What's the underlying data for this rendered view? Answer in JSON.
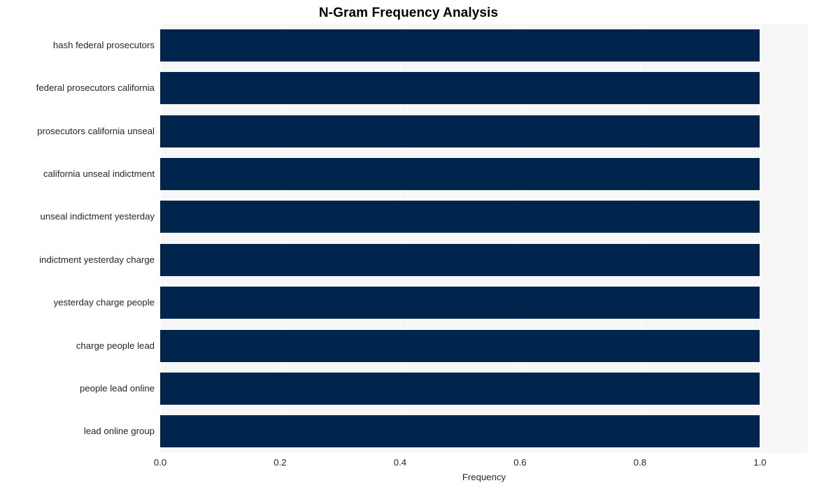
{
  "chart_data": {
    "type": "bar",
    "orientation": "horizontal",
    "title": "N-Gram Frequency Analysis",
    "xlabel": "Frequency",
    "ylabel": "",
    "categories": [
      "hash federal prosecutors",
      "federal prosecutors california",
      "prosecutors california unseal",
      "california unseal indictment",
      "unseal indictment yesterday",
      "indictment yesterday charge",
      "yesterday charge people",
      "charge people lead",
      "people lead online",
      "lead online group"
    ],
    "values": [
      1.0,
      1.0,
      1.0,
      1.0,
      1.0,
      1.0,
      1.0,
      1.0,
      1.0,
      1.0
    ],
    "xlim": [
      0.0,
      1.08
    ],
    "xticks": [
      0.0,
      0.2,
      0.4,
      0.6,
      0.8,
      1.0
    ],
    "xtick_labels": [
      "0.0",
      "0.2",
      "0.4",
      "0.6",
      "0.8",
      "1.0"
    ],
    "grid": true,
    "grid_axis": "x",
    "legend": false,
    "bar_color": "#00254d",
    "plot_background": "#f7f7f7",
    "grid_color": "#ffffff",
    "figure_background": "#ffffff",
    "text_color": "#262626",
    "title_color": "#000000"
  }
}
